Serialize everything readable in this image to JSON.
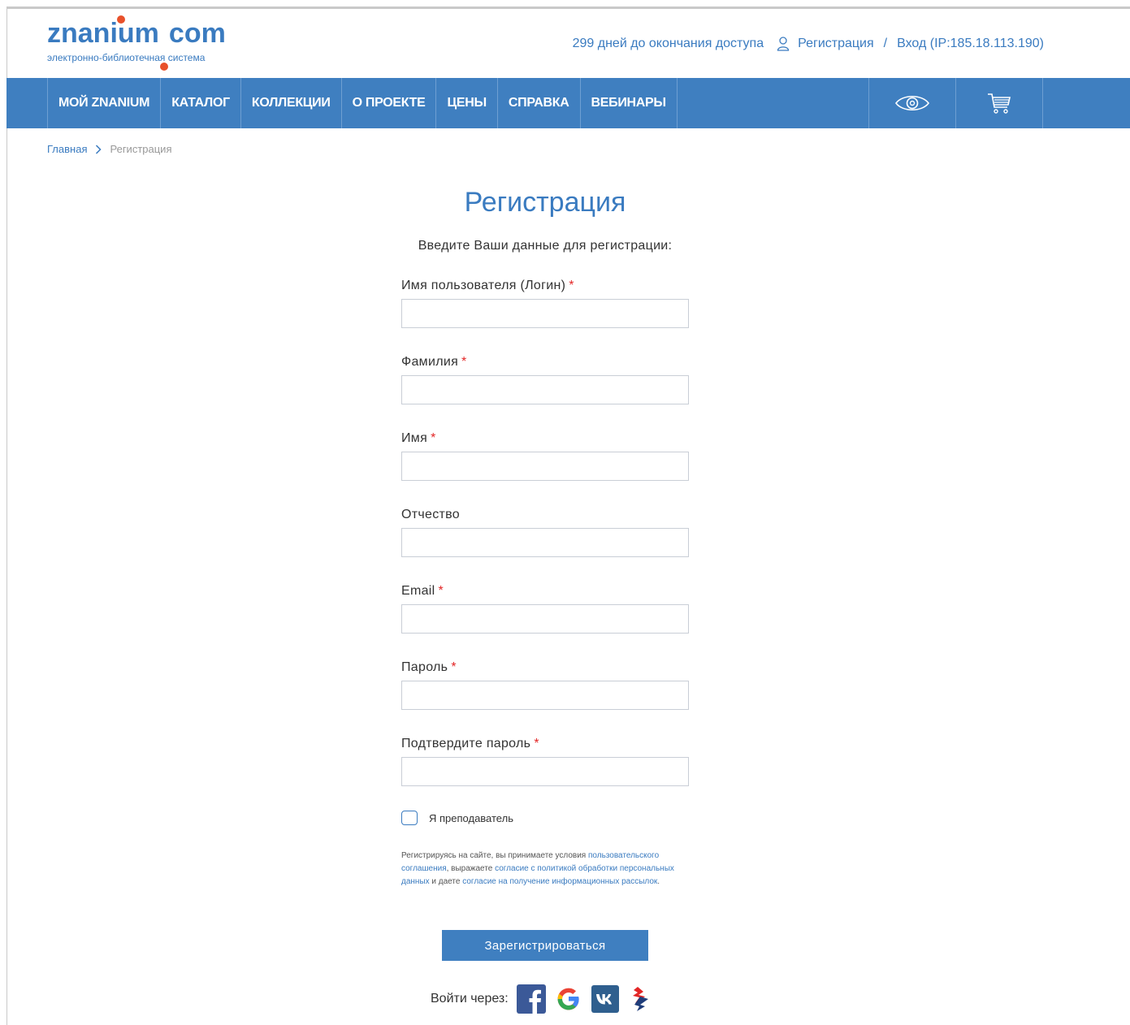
{
  "logo": {
    "name_part1": "znani",
    "name_part2": "um",
    "name_part3": "com",
    "tagline": "электронно-библиотечная система"
  },
  "header": {
    "access_days": "299 дней до окончания доступа",
    "register": "Регистрация",
    "separator": "/",
    "login": "Вход (IP:185.18.113.190)"
  },
  "nav": {
    "items": [
      "Мой ZNANIUM",
      "Каталог",
      "Коллекции",
      "О проекте",
      "Цены",
      "Справка",
      "Вебинары"
    ],
    "icons": [
      "eye-icon",
      "cart-icon"
    ]
  },
  "breadcrumb": {
    "home": "Главная",
    "current": "Регистрация"
  },
  "form": {
    "title": "Регистрация",
    "subtitle": "Введите Ваши данные для регистрации:",
    "required_mark": "*",
    "fields": [
      {
        "label": "Имя пользователя (Логин)",
        "required": true,
        "value": ""
      },
      {
        "label": "Фамилия",
        "required": true,
        "value": ""
      },
      {
        "label": "Имя",
        "required": true,
        "value": ""
      },
      {
        "label": "Отчество",
        "required": false,
        "value": ""
      },
      {
        "label": "Email",
        "required": true,
        "value": ""
      },
      {
        "label": "Пароль",
        "required": true,
        "value": ""
      },
      {
        "label": "Подтвердите пароль",
        "required": true,
        "value": ""
      }
    ],
    "teacher_checkbox": "Я преподаватель",
    "terms": {
      "t1": "Регистрируясь на сайте, вы принимаете условия ",
      "l1": "пользовательского соглашения",
      "t2": ", выражаете ",
      "l2": "согласие с политикой обработки персональных данных",
      "t3": " и даете ",
      "l3": "согласие на получение информационных рассылок",
      "t4": "."
    },
    "submit": "Зарегистрироваться",
    "social_label": "Войти через:",
    "social_icons": [
      "facebook-icon",
      "google-icon",
      "vk-icon",
      "esia-icon"
    ]
  },
  "colors": {
    "brand_blue": "#3f7fc0",
    "link_blue": "#3a7bc0",
    "accent_orange": "#e8512b",
    "required_red": "#e32626"
  }
}
